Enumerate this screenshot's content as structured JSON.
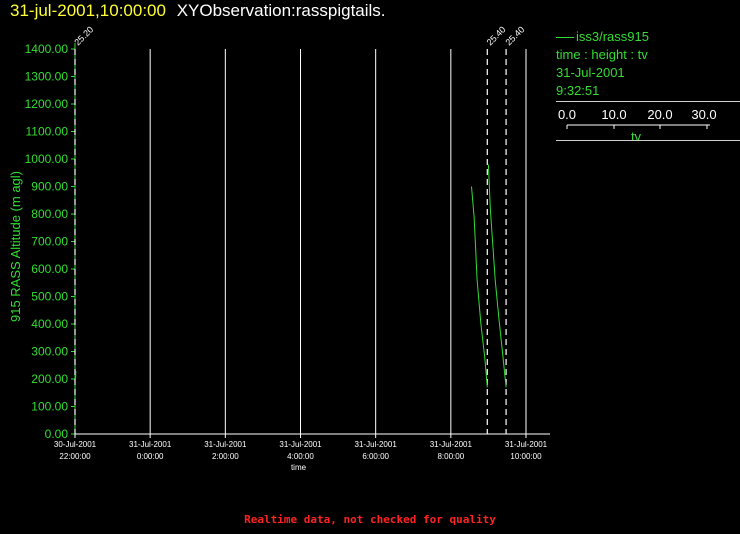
{
  "header": {
    "timestamp": "31-jul-2001,10:00:00",
    "title": "XYObservation:rasspigtails."
  },
  "legend": {
    "series_label": "iss3/rass915",
    "quantity": "time : height : tv",
    "date": "31-Jul-2001",
    "time": "9:32:51",
    "scale": {
      "ticks": [
        "0.0",
        "10.0",
        "20.0",
        "30.0"
      ],
      "label": "tv"
    }
  },
  "footer": {
    "note": "Realtime data, not checked for quality"
  },
  "colors": {
    "accent": "#33dd33",
    "timestamp": "#ffff33",
    "warning": "#ff2222",
    "grid": "#ffffff"
  },
  "chart_data": {
    "type": "line",
    "ylabel": "915 RASS Altitude (m agl)",
    "xlabel": "time",
    "ylim": [
      0,
      1400
    ],
    "yticks": [
      "0.00",
      "100.00",
      "200.00",
      "300.00",
      "400.00",
      "500.00",
      "600.00",
      "700.00",
      "800.00",
      "900.00",
      "1000.00",
      "1100.00",
      "1200.00",
      "1300.00",
      "1400.00"
    ],
    "xlim_hours": [
      -2,
      10
    ],
    "xticks": [
      {
        "date": "30-Jul-2001",
        "time": "22:00:00",
        "hour": -2
      },
      {
        "date": "31-Jul-2001",
        "time": "0:00:00",
        "hour": 0
      },
      {
        "date": "31-Jul-2001",
        "time": "2:00:00",
        "hour": 2
      },
      {
        "date": "31-Jul-2001",
        "time": "4:00:00",
        "hour": 4
      },
      {
        "date": "31-Jul-2001",
        "time": "6:00:00",
        "hour": 6
      },
      {
        "date": "31-Jul-2001",
        "time": "8:00:00",
        "hour": 8
      },
      {
        "date": "31-Jul-2001",
        "time": "10:00:00",
        "hour": 10
      }
    ],
    "grid": true,
    "profile_markers": [
      {
        "hour": -2.0,
        "label": "25.20"
      },
      {
        "hour": 8.97,
        "label": "25.40"
      },
      {
        "hour": 9.47,
        "label": "25.40"
      }
    ],
    "series": [
      {
        "points": [
          [
            -1.98,
            230
          ],
          [
            -1.99,
            180
          ]
        ]
      },
      {
        "points": [
          [
            8.55,
            900
          ],
          [
            8.62,
            790
          ],
          [
            8.65,
            700
          ],
          [
            8.7,
            560
          ],
          [
            8.8,
            400
          ],
          [
            8.9,
            280
          ],
          [
            8.97,
            170
          ]
        ]
      },
      {
        "points": [
          [
            9.0,
            980
          ],
          [
            9.05,
            820
          ],
          [
            9.1,
            720
          ],
          [
            9.18,
            560
          ],
          [
            9.28,
            420
          ],
          [
            9.38,
            290
          ],
          [
            9.47,
            170
          ]
        ]
      }
    ]
  }
}
